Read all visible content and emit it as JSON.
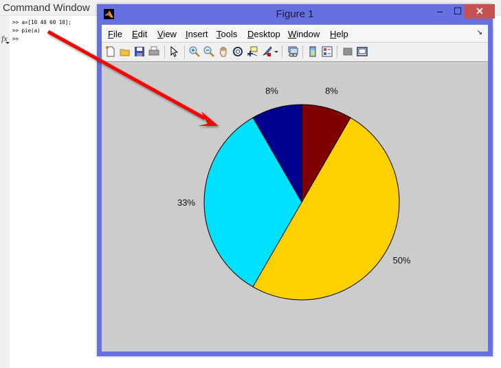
{
  "command_window": {
    "title": "Command Window",
    "lines": [
      ">> a=[10 40 60 10];",
      ">> pie(a)",
      ">>"
    ],
    "fx_label": "fx"
  },
  "figure": {
    "title": "Figure 1",
    "controls": {
      "minimize": "–",
      "maximize": "☐",
      "close": "✕"
    },
    "menu": [
      {
        "key": "F",
        "rest": "ile"
      },
      {
        "key": "E",
        "rest": "dit"
      },
      {
        "key": "V",
        "rest": "iew"
      },
      {
        "key": "I",
        "rest": "nsert"
      },
      {
        "key": "T",
        "rest": "ools"
      },
      {
        "key": "D",
        "rest": "esktop"
      },
      {
        "key": "W",
        "rest": "indow"
      },
      {
        "key": "H",
        "rest": "elp"
      }
    ],
    "dock_glyph": "↘",
    "toolbar_icons": [
      "new-figure",
      "open-file",
      "save",
      "print",
      "edit-plot",
      "zoom-in",
      "zoom-out",
      "pan",
      "rotate-3d",
      "data-cursor",
      "brush",
      "link-plot",
      "colorbar",
      "legend",
      "hide-plot-tools",
      "show-plot-tools"
    ]
  },
  "colors": {
    "window_frame": "#6670e0",
    "plot_bg": "#cccccc",
    "annotation_arrow": "#ff0000"
  },
  "chart_data": {
    "type": "pie",
    "values": [
      10,
      40,
      60,
      10
    ],
    "labels": [
      "8%",
      "33%",
      "50%",
      "8%"
    ],
    "colors": [
      "#00008f",
      "#00e0ff",
      "#ffd000",
      "#800000"
    ],
    "direction": "counterclockwise",
    "start_angle_deg": 90,
    "title": "",
    "legend": "none"
  }
}
